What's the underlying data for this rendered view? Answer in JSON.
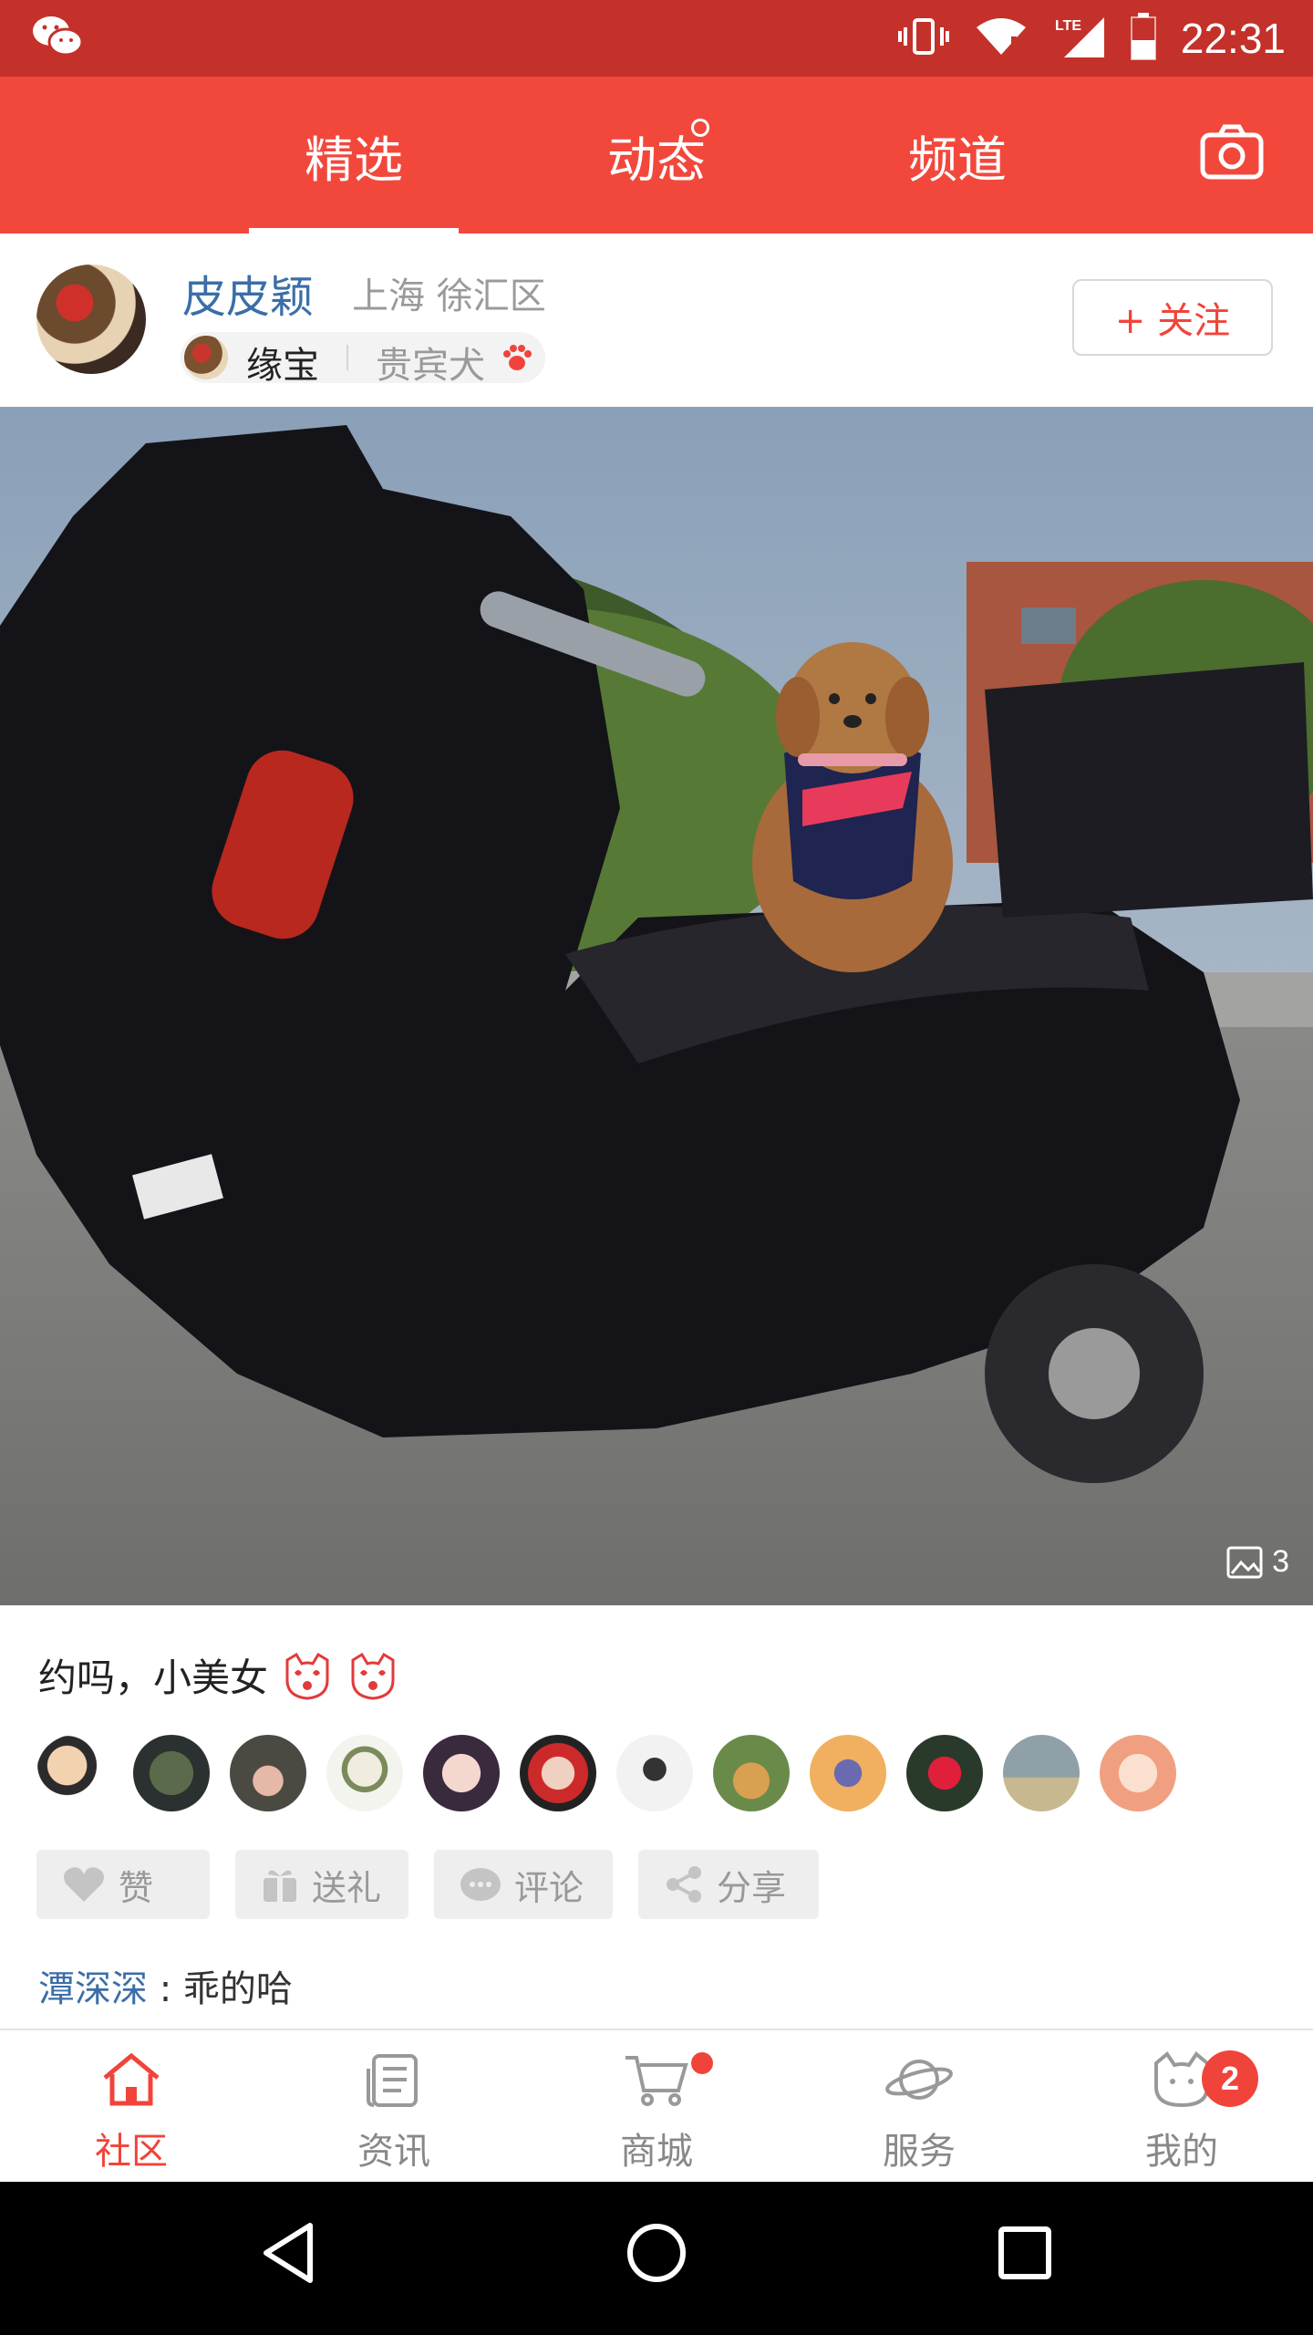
{
  "status_bar": {
    "time": "22:31",
    "network": "LTE"
  },
  "top_tabs": [
    {
      "label": "精选",
      "active": true
    },
    {
      "label": "动态",
      "has_dot": true
    },
    {
      "label": "频道"
    }
  ],
  "post": {
    "username": "皮皮颖",
    "location": "上海 徐汇区",
    "pet": {
      "name": "缘宝",
      "breed": "贵宾犬"
    },
    "follow_label": "+ 关注",
    "image_count": "3",
    "caption": "约吗，小美女",
    "actions": [
      {
        "label": "赞",
        "icon": "heart-icon"
      },
      {
        "label": "送礼",
        "icon": "gift-icon"
      },
      {
        "label": "评论",
        "icon": "comment-icon"
      },
      {
        "label": "分享",
        "icon": "share-icon"
      }
    ],
    "liker_count": 12,
    "comment": {
      "author": "潭深深",
      "separator": " : ",
      "text": "乖的哈"
    }
  },
  "bottom_nav": [
    {
      "label": "社区",
      "icon": "home-icon",
      "active": true
    },
    {
      "label": "资讯",
      "icon": "news-icon"
    },
    {
      "label": "商城",
      "icon": "cart-icon",
      "has_dot": true
    },
    {
      "label": "服务",
      "icon": "planet-icon"
    },
    {
      "label": "我的",
      "icon": "cat-face-icon",
      "badge": "2"
    }
  ],
  "colors": {
    "accent": "#f2483c",
    "status_bar": "#c3312a",
    "link_blue": "#3b6ea8",
    "muted": "#9a9a9a"
  }
}
